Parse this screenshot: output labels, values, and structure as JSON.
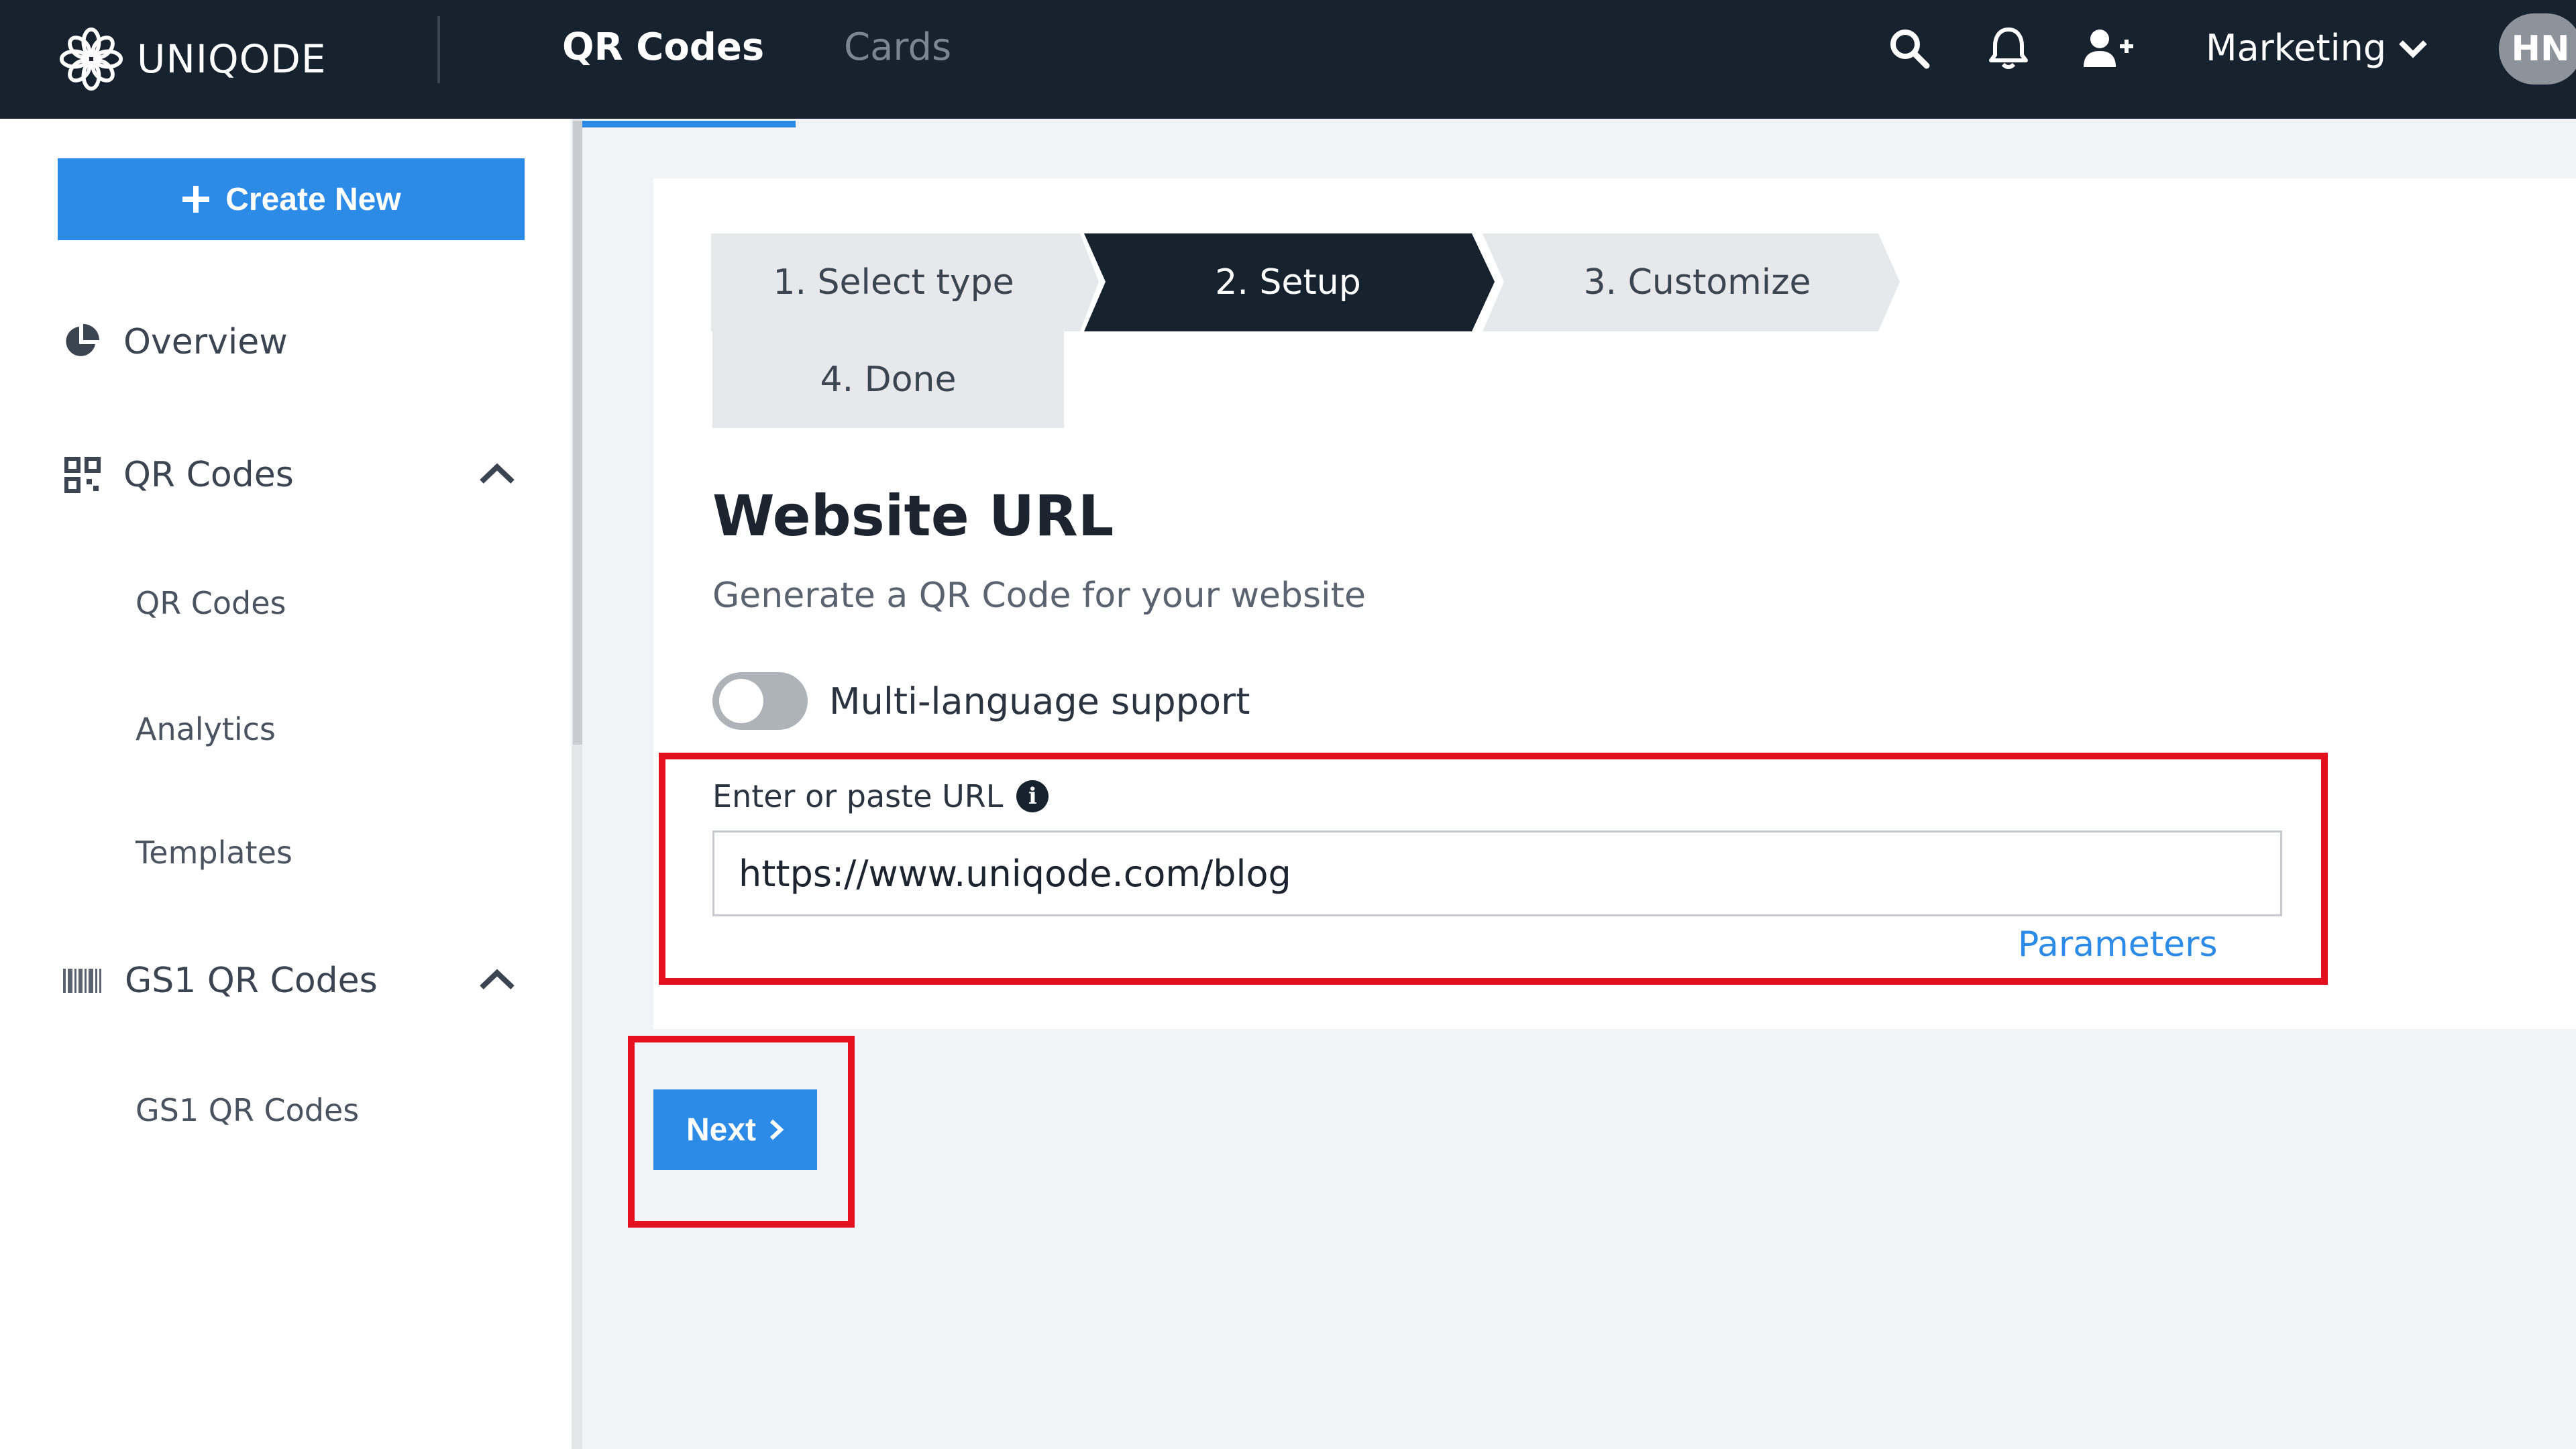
{
  "app": {
    "brand": "UNIQODE"
  },
  "topnav": {
    "tabs": [
      {
        "label": "QR Codes",
        "active": true
      },
      {
        "label": "Cards",
        "active": false
      }
    ],
    "icons": [
      "search-icon",
      "bell-icon",
      "add-user-icon"
    ],
    "workspace": "Marketing",
    "avatar_initials": "HN"
  },
  "sidebar": {
    "create_button": "Create New",
    "items": [
      {
        "label": "Overview",
        "icon": "pie-chart-icon"
      },
      {
        "label": "QR Codes",
        "icon": "qr-grid-icon",
        "expanded": true,
        "children": [
          "QR Codes",
          "Analytics",
          "Templates"
        ]
      },
      {
        "label": "GS1 QR Codes",
        "icon": "barcode-icon",
        "expanded": true,
        "children": [
          "GS1 QR Codes"
        ]
      }
    ]
  },
  "stepper": {
    "steps": [
      {
        "label": "1. Select type",
        "state": "done"
      },
      {
        "label": "2. Setup",
        "state": "active"
      },
      {
        "label": "3. Customize",
        "state": "pending"
      },
      {
        "label": "4. Done",
        "state": "pending"
      }
    ]
  },
  "form": {
    "title": "Website URL",
    "subtitle": "Generate a QR Code for your website",
    "multilang_label": "Multi-language support",
    "multilang_enabled": false,
    "url_label": "Enter or paste URL",
    "url_value": "https://www.uniqode.com/blog",
    "parameters_link": "Parameters",
    "next_button": "Next"
  },
  "colors": {
    "topbar": "#17222f",
    "accent": "#2b8be6",
    "highlight": "#e5101f",
    "step_active": "#17222f",
    "step_inactive": "#e6e8eb"
  }
}
